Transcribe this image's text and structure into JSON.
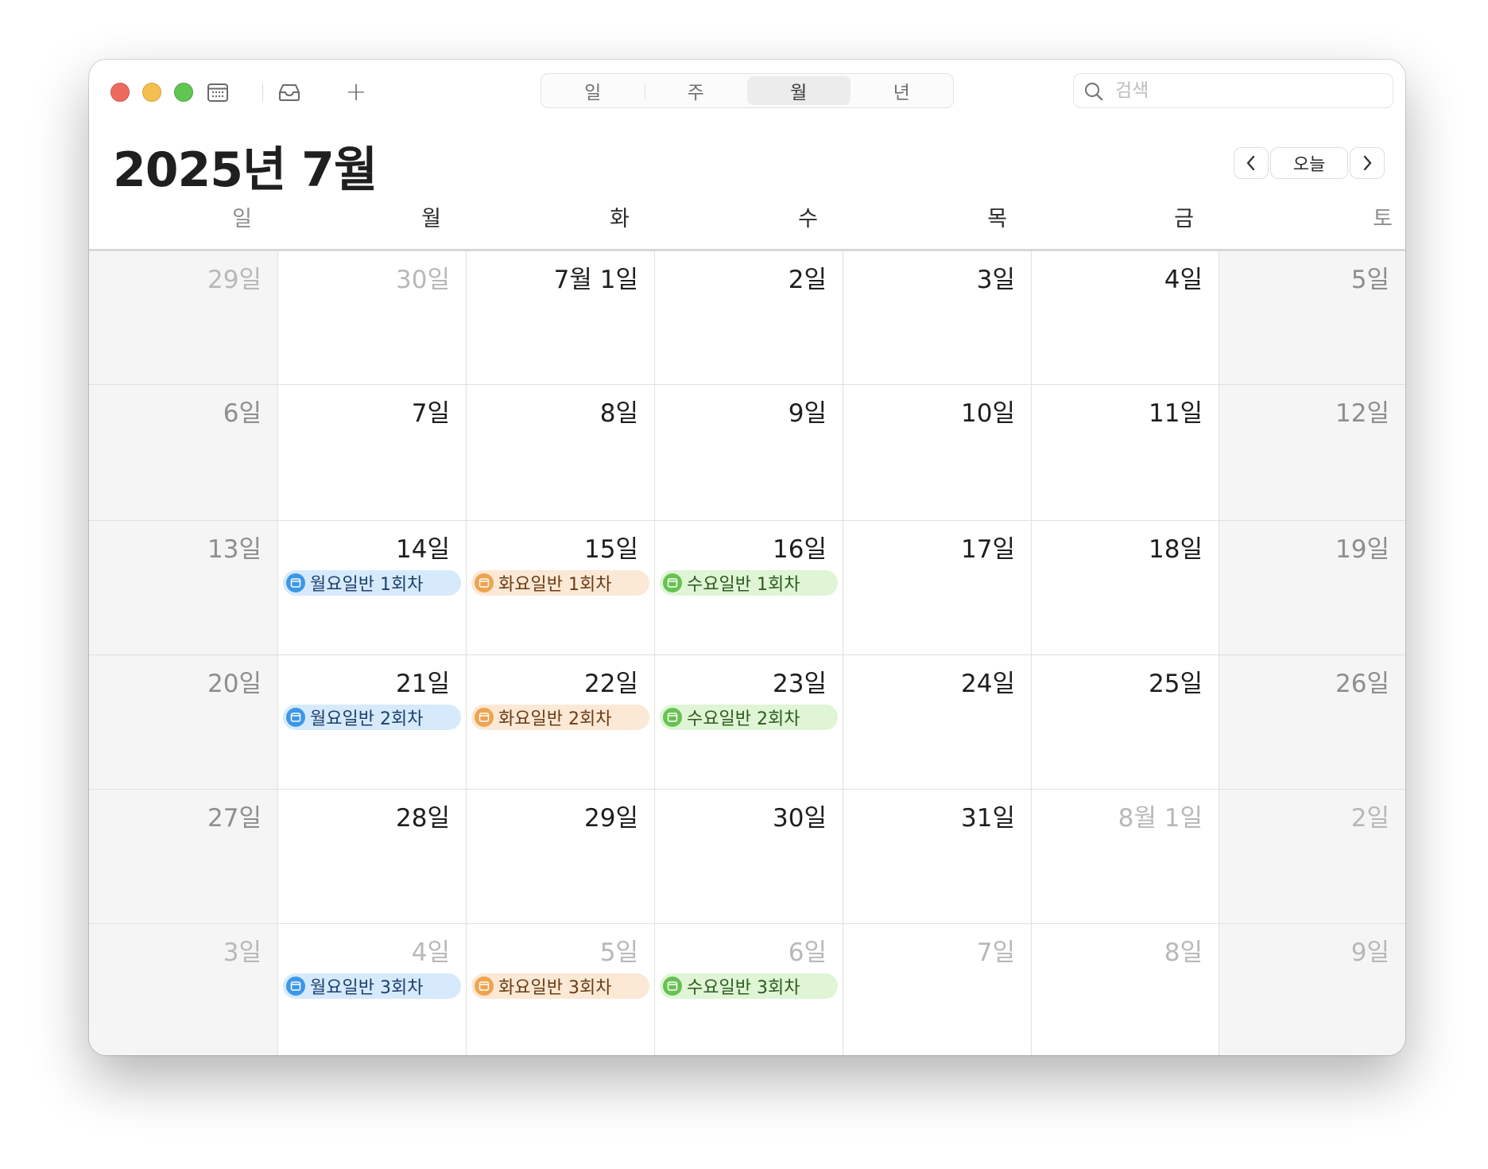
{
  "toolbar": {
    "view_tabs": [
      {
        "label": "일",
        "active": false
      },
      {
        "label": "주",
        "active": false
      },
      {
        "label": "월",
        "active": true
      },
      {
        "label": "년",
        "active": false
      }
    ],
    "search_placeholder": "검색",
    "icons": [
      "calendar-list-icon",
      "inbox-icon",
      "plus-icon",
      "search-icon"
    ]
  },
  "header": {
    "month_title": "2025년 7월",
    "today_label": "오늘"
  },
  "weekdays": [
    "일",
    "월",
    "화",
    "수",
    "목",
    "금",
    "토"
  ],
  "weeks": [
    {
      "days": [
        {
          "label": "29일",
          "in_month": false
        },
        {
          "label": "30일",
          "in_month": false
        },
        {
          "label": "7월 1일",
          "in_month": true
        },
        {
          "label": "2일",
          "in_month": true
        },
        {
          "label": "3일",
          "in_month": true
        },
        {
          "label": "4일",
          "in_month": true
        },
        {
          "label": "5일",
          "in_month": true
        }
      ],
      "events": []
    },
    {
      "days": [
        {
          "label": "6일",
          "in_month": true
        },
        {
          "label": "7일",
          "in_month": true
        },
        {
          "label": "8일",
          "in_month": true
        },
        {
          "label": "9일",
          "in_month": true
        },
        {
          "label": "10일",
          "in_month": true
        },
        {
          "label": "11일",
          "in_month": true
        },
        {
          "label": "12일",
          "in_month": true
        }
      ],
      "events": []
    },
    {
      "days": [
        {
          "label": "13일",
          "in_month": true
        },
        {
          "label": "14일",
          "in_month": true
        },
        {
          "label": "15일",
          "in_month": true
        },
        {
          "label": "16일",
          "in_month": true
        },
        {
          "label": "17일",
          "in_month": true
        },
        {
          "label": "18일",
          "in_month": true
        },
        {
          "label": "19일",
          "in_month": true
        }
      ],
      "events": [
        {
          "day": 1,
          "title": "월요일반 1회차",
          "color": "blue"
        },
        {
          "day": 2,
          "title": "화요일반 1회차",
          "color": "orange"
        },
        {
          "day": 3,
          "title": "수요일반 1회차",
          "color": "green"
        }
      ]
    },
    {
      "days": [
        {
          "label": "20일",
          "in_month": true
        },
        {
          "label": "21일",
          "in_month": true
        },
        {
          "label": "22일",
          "in_month": true
        },
        {
          "label": "23일",
          "in_month": true
        },
        {
          "label": "24일",
          "in_month": true
        },
        {
          "label": "25일",
          "in_month": true
        },
        {
          "label": "26일",
          "in_month": true
        }
      ],
      "events": [
        {
          "day": 1,
          "title": "월요일반 2회차",
          "color": "blue"
        },
        {
          "day": 2,
          "title": "화요일반 2회차",
          "color": "orange"
        },
        {
          "day": 3,
          "title": "수요일반 2회차",
          "color": "green"
        }
      ]
    },
    {
      "days": [
        {
          "label": "27일",
          "in_month": true
        },
        {
          "label": "28일",
          "in_month": true
        },
        {
          "label": "29일",
          "in_month": true
        },
        {
          "label": "30일",
          "in_month": true
        },
        {
          "label": "31일",
          "in_month": true
        },
        {
          "label": "8월 1일",
          "in_month": false
        },
        {
          "label": "2일",
          "in_month": false
        }
      ],
      "events": []
    },
    {
      "days": [
        {
          "label": "3일",
          "in_month": false
        },
        {
          "label": "4일",
          "in_month": false
        },
        {
          "label": "5일",
          "in_month": false
        },
        {
          "label": "6일",
          "in_month": false
        },
        {
          "label": "7일",
          "in_month": false
        },
        {
          "label": "8일",
          "in_month": false
        },
        {
          "label": "9일",
          "in_month": false
        }
      ],
      "events": [
        {
          "day": 1,
          "title": "월요일반 3회차",
          "color": "blue"
        },
        {
          "day": 2,
          "title": "화요일반 3회차",
          "color": "orange"
        },
        {
          "day": 3,
          "title": "수요일반 3회차",
          "color": "green"
        }
      ]
    }
  ],
  "colors": {
    "blue": "#3d97e8",
    "orange": "#eea44f",
    "green": "#67c252",
    "close": "#ed6a5e",
    "minimize": "#f5bf4f",
    "zoom": "#61c554"
  }
}
